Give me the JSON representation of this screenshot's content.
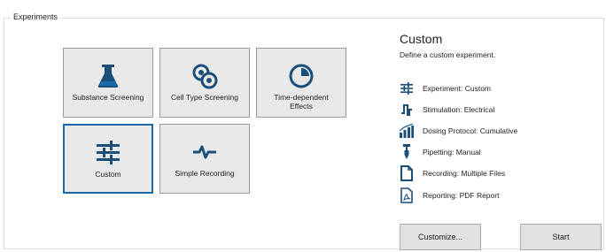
{
  "group": {
    "title": "Experiments"
  },
  "tiles": [
    {
      "label": "Substance Screening",
      "icon": "flask-icon"
    },
    {
      "label": "Cell Type Screening",
      "icon": "cells-icon"
    },
    {
      "label": "Time-dependent Effects",
      "icon": "clock-icon"
    },
    {
      "label": "Custom",
      "icon": "sliders-icon",
      "selected": true
    },
    {
      "label": "Simple Recording",
      "icon": "pulse-icon"
    }
  ],
  "detail": {
    "title": "Custom",
    "description": "Define a custom experiment.",
    "properties": [
      {
        "label": "Experiment: Custom",
        "icon": "sliders-icon"
      },
      {
        "label": "Stimulation: Electrical",
        "icon": "stimulation-icon"
      },
      {
        "label": "Dosing Protocol: Cumulative",
        "icon": "bar-chart-icon"
      },
      {
        "label": "Pipetting: Manual",
        "icon": "pipette-icon"
      },
      {
        "label": "Recording: Multiple Files",
        "icon": "files-icon"
      },
      {
        "label": "Reporting: PDF Report",
        "icon": "pdf-icon"
      }
    ]
  },
  "buttons": {
    "customize": "Customize...",
    "start": "Start"
  },
  "colors": {
    "accent": "#1b6aa8",
    "tile_bg": "#e8e8e8",
    "icon": "#1b4f7a"
  }
}
